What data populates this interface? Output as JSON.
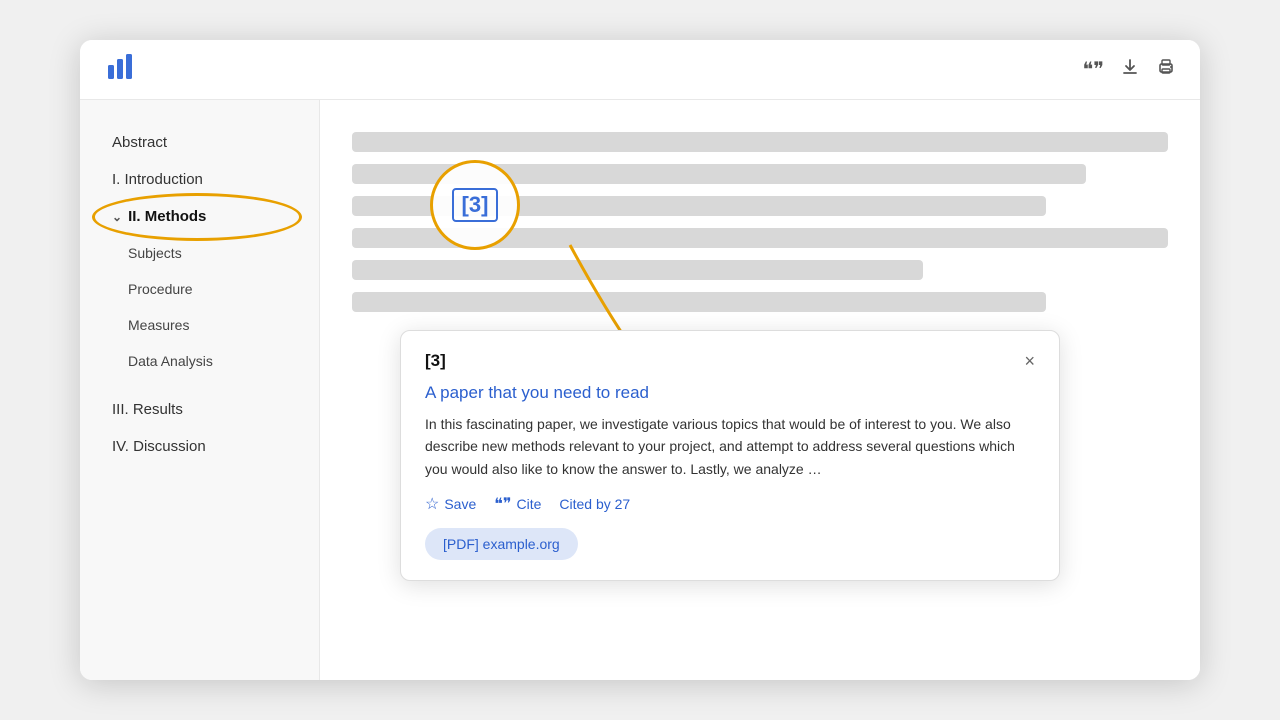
{
  "header": {
    "logo_alt": "App logo"
  },
  "toolbar": {
    "quote_icon": "❝",
    "download_icon": "↓",
    "print_icon": "🖨"
  },
  "sidebar": {
    "items": [
      {
        "id": "abstract",
        "label": "Abstract",
        "active": false,
        "sub": false
      },
      {
        "id": "introduction",
        "label": "I. Introduction",
        "active": false,
        "sub": false
      },
      {
        "id": "methods",
        "label": "II. Methods",
        "active": true,
        "sub": false
      },
      {
        "id": "subjects",
        "label": "Subjects",
        "active": false,
        "sub": true
      },
      {
        "id": "procedure",
        "label": "Procedure",
        "active": false,
        "sub": true
      },
      {
        "id": "measures",
        "label": "Measures",
        "active": false,
        "sub": true
      },
      {
        "id": "data-analysis",
        "label": "Data Analysis",
        "active": false,
        "sub": true
      },
      {
        "id": "results",
        "label": "III. Results",
        "active": false,
        "sub": false
      },
      {
        "id": "discussion",
        "label": "IV. Discussion",
        "active": false,
        "sub": false
      }
    ]
  },
  "citation_callout": {
    "label": "[3]"
  },
  "popup": {
    "ref_num": "[3]",
    "title": "A paper that you need to read",
    "abstract": "In this fascinating paper, we investigate various topics that would be of interest to you. We also describe new methods relevant to your project, and attempt to address several questions which you would also like to know the answer to. Lastly, we analyze …",
    "save_label": "Save",
    "cite_label": "Cite",
    "cited_by_label": "Cited by 27",
    "pdf_label": "[PDF] example.org",
    "close_label": "×"
  }
}
